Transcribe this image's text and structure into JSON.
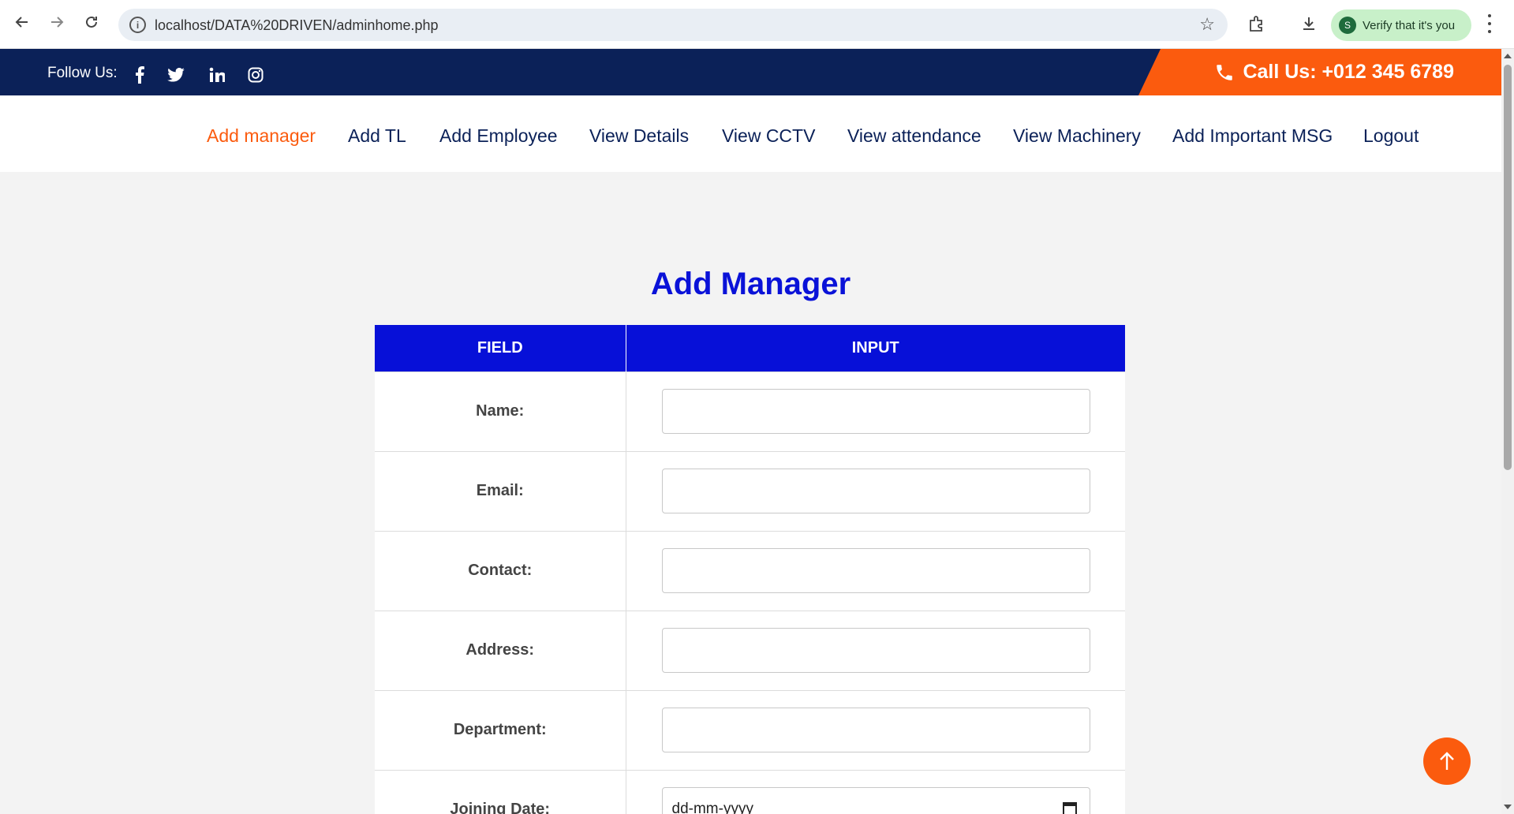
{
  "browser": {
    "url": "localhost/DATA%20DRIVEN/adminhome.php",
    "verify_label": "Verify that it's you",
    "profile_initial": "S"
  },
  "topbar": {
    "follow_label": "Follow Us:",
    "social_icons": [
      "facebook-icon",
      "twitter-icon",
      "linkedin-icon",
      "instagram-icon"
    ],
    "call_label": "Call Us:  +012 345 6789"
  },
  "nav": {
    "items": [
      {
        "label": "Add manager",
        "active": true
      },
      {
        "label": "Add TL"
      },
      {
        "label": "Add Employee"
      },
      {
        "label": "View Details"
      },
      {
        "label": "View CCTV"
      },
      {
        "label": "View attendance"
      },
      {
        "label": "View Machinery"
      },
      {
        "label": "Add Important MSG"
      },
      {
        "label": "Logout"
      }
    ]
  },
  "form": {
    "title": "Add Manager",
    "col_field": "FIELD",
    "col_input": "INPUT",
    "rows": [
      {
        "label": "Name:",
        "value": ""
      },
      {
        "label": "Email:",
        "value": ""
      },
      {
        "label": "Contact:",
        "value": ""
      },
      {
        "label": "Address:",
        "value": ""
      },
      {
        "label": "Department:",
        "value": ""
      },
      {
        "label": "Joining Date:",
        "value": "dd-mm-yyyy"
      }
    ]
  },
  "colors": {
    "brand_navy": "#0b2158",
    "accent_orange": "#fb5b0e",
    "header_blue": "#0710d8"
  }
}
